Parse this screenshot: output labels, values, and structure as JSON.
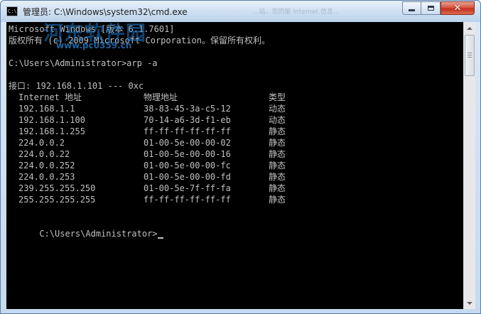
{
  "window": {
    "title": "管理员: C:\\Windows\\system32\\cmd.exe",
    "watermark_title": "...站，您的能 Internet 信息...",
    "icon_text": "C:\\",
    "close_glyph": "✕"
  },
  "watermark": {
    "brand": "河东软件园",
    "url": "www.pc0359.cn"
  },
  "console": {
    "header_line1": "Microsoft Windows [版本 6.1.7601]",
    "header_line2": "版权所有 (c) 2009 Microsoft Corporation。保留所有权利。",
    "prompt1": "C:\\Users\\Administrator>arp -a",
    "interface_line": "接口: 192.168.1.101 --- 0xc",
    "columns": {
      "ip": "Internet 地址",
      "mac": "物理地址",
      "type": "类型"
    },
    "rows": [
      {
        "ip": "192.168.1.1",
        "mac": "38-83-45-3a-c5-12",
        "type": "动态"
      },
      {
        "ip": "192.168.1.100",
        "mac": "70-14-a6-3d-f1-eb",
        "type": "动态"
      },
      {
        "ip": "192.168.1.255",
        "mac": "ff-ff-ff-ff-ff-ff",
        "type": "静态"
      },
      {
        "ip": "224.0.0.2",
        "mac": "01-00-5e-00-00-02",
        "type": "静态"
      },
      {
        "ip": "224.0.0.22",
        "mac": "01-00-5e-00-00-16",
        "type": "静态"
      },
      {
        "ip": "224.0.0.252",
        "mac": "01-00-5e-00-00-fc",
        "type": "静态"
      },
      {
        "ip": "224.0.0.253",
        "mac": "01-00-5e-00-00-fd",
        "type": "静态"
      },
      {
        "ip": "239.255.255.250",
        "mac": "01-00-5e-7f-ff-fa",
        "type": "静态"
      },
      {
        "ip": "255.255.255.255",
        "mac": "ff-ff-ff-ff-ff-ff",
        "type": "静态"
      }
    ],
    "prompt2": "C:\\Users\\Administrator>"
  },
  "colors": {
    "console_bg": "#000000",
    "console_text": "#c0c0c0",
    "close_button": "#c4321f"
  },
  "icons": [
    "cmd-app-icon",
    "minimize-icon",
    "maximize-icon",
    "close-icon",
    "scroll-up-icon",
    "scroll-down-icon"
  ]
}
